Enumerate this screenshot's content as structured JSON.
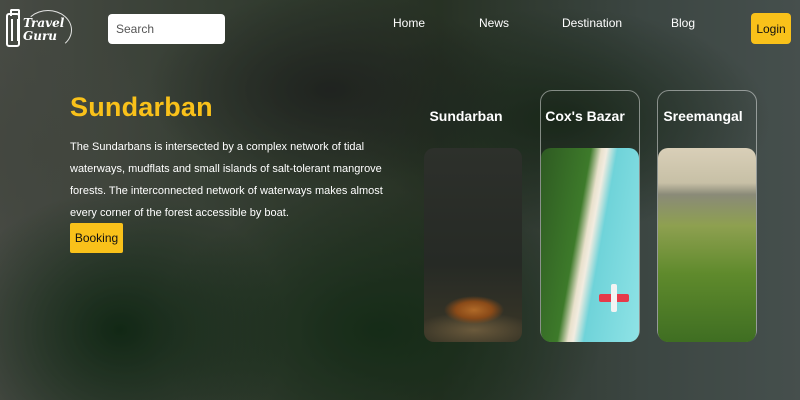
{
  "brand": {
    "logo_line1": "Travel",
    "logo_line2": "Guru"
  },
  "search": {
    "placeholder": "Search"
  },
  "nav": {
    "links": [
      "Home",
      "News",
      "Destination",
      "Blog"
    ],
    "login_label": "Login"
  },
  "hero": {
    "title": "Sundarban",
    "description": "The Sundarbans is intersected by a complex network of tidal waterways, mudflats and small islands of salt-tolerant mangrove forests. The interconnected network of waterways makes almost every corner of the forest accessible by boat.",
    "button_label": "Booking"
  },
  "destinations": [
    {
      "title": "Sundarban"
    },
    {
      "title": "Cox's Bazar"
    },
    {
      "title": "Sreemangal"
    }
  ],
  "colors": {
    "accent": "#f9c11a",
    "text": "#ffffff"
  }
}
